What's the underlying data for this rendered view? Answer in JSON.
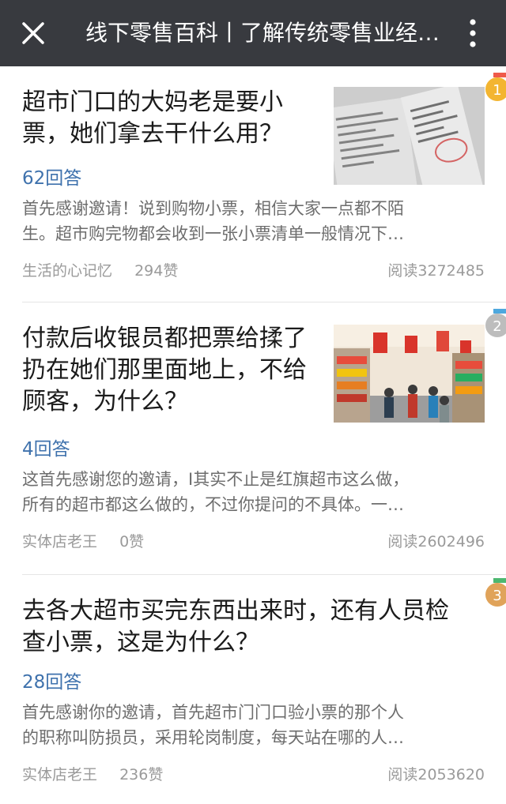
{
  "topbar": {
    "title": "线下零售百科丨了解传统零售业经…",
    "close_icon": "close-icon",
    "more_icon": "more-vertical-icon",
    "background": "#383a3f"
  },
  "articles": [
    {
      "rank": "1",
      "rank_color": "#f3b531",
      "tab_color": "#ef5a4a",
      "title_lines": [
        "超市门口的大妈老是要小",
        "票，她们拿去干什么用？"
      ],
      "answers": "62回答",
      "excerpt_lines": [
        "首先感谢邀请！说到购物小票，相信大家一点都不陌",
        "生。超市购完物都会收到一张小票清单一般情况下…"
      ],
      "author": "生活的心记忆",
      "likes": "294赞",
      "reads": "阅读3272485"
    },
    {
      "rank": "2",
      "rank_color": "#bdbdbd",
      "tab_color": "#4ea8de",
      "title_lines": [
        "付款后收银员都把票给揉了",
        "扔在她们那里面地上，不给",
        "顾客，为什么？"
      ],
      "answers": "4回答",
      "excerpt_lines": [
        "这首先感谢您的邀请，I其实不止是红旗超市这么做，",
        "所有的超市都这么做的，不过你提问的不具体。一…"
      ],
      "author": "实体店老王",
      "likes": "0赞",
      "reads": "阅读2602496"
    },
    {
      "rank": "3",
      "rank_color": "#e0a35a",
      "tab_color": "#4cb870",
      "title_lines": [
        "去各大超市买完东西出来时，还有人员检",
        "查小票，这是为什么？"
      ],
      "answers": "28回答",
      "excerpt_lines": [
        "首先感谢你的邀请，首先超市门门口验小票的那个人",
        "的职称叫防损员，采用轮岗制度，每天站在哪的人…"
      ],
      "author": "实体店老王",
      "likes": "236赞",
      "reads": "阅读2053620"
    }
  ]
}
